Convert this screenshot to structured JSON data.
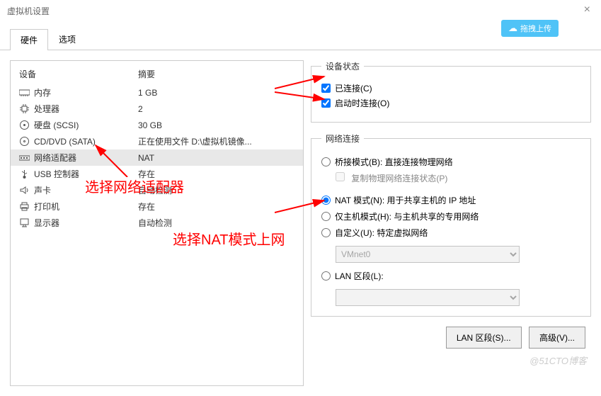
{
  "window": {
    "title": "虚拟机设置"
  },
  "upload": {
    "label": "拖拽上传"
  },
  "tabs": {
    "hardware": "硬件",
    "options": "选项"
  },
  "cols": {
    "device": "设备",
    "summary": "摘要"
  },
  "devices": {
    "memory": {
      "label": "内存",
      "summary": "1 GB"
    },
    "cpu": {
      "label": "处理器",
      "summary": "2"
    },
    "disk": {
      "label": "硬盘 (SCSI)",
      "summary": "30 GB"
    },
    "cd": {
      "label": "CD/DVD (SATA)",
      "summary": "正在使用文件 D:\\虚拟机镜像..."
    },
    "net": {
      "label": "网络适配器",
      "summary": "NAT"
    },
    "usb": {
      "label": "USB 控制器",
      "summary": "存在"
    },
    "sound": {
      "label": "声卡",
      "summary": "自动检测"
    },
    "printer": {
      "label": "打印机",
      "summary": "存在"
    },
    "display": {
      "label": "显示器",
      "summary": "自动检测"
    }
  },
  "status": {
    "legend": "设备状态",
    "connected": "已连接(C)",
    "atpoweron": "启动时连接(O)"
  },
  "network": {
    "legend": "网络连接",
    "bridged": "桥接模式(B): 直接连接物理网络",
    "replicate": "复制物理网络连接状态(P)",
    "nat": "NAT 模式(N): 用于共享主机的 IP 地址",
    "hostonly": "仅主机模式(H): 与主机共享的专用网络",
    "custom": "自定义(U): 特定虚拟网络",
    "vmnet0": "VMnet0",
    "lan": "LAN 区段(L):"
  },
  "buttons": {
    "lanseg": "LAN 区段(S)...",
    "advanced": "高级(V)..."
  },
  "annotations": {
    "a1": "选择网络适配器",
    "a2": "选择NAT模式上网"
  },
  "watermark": "@51CTO博客"
}
